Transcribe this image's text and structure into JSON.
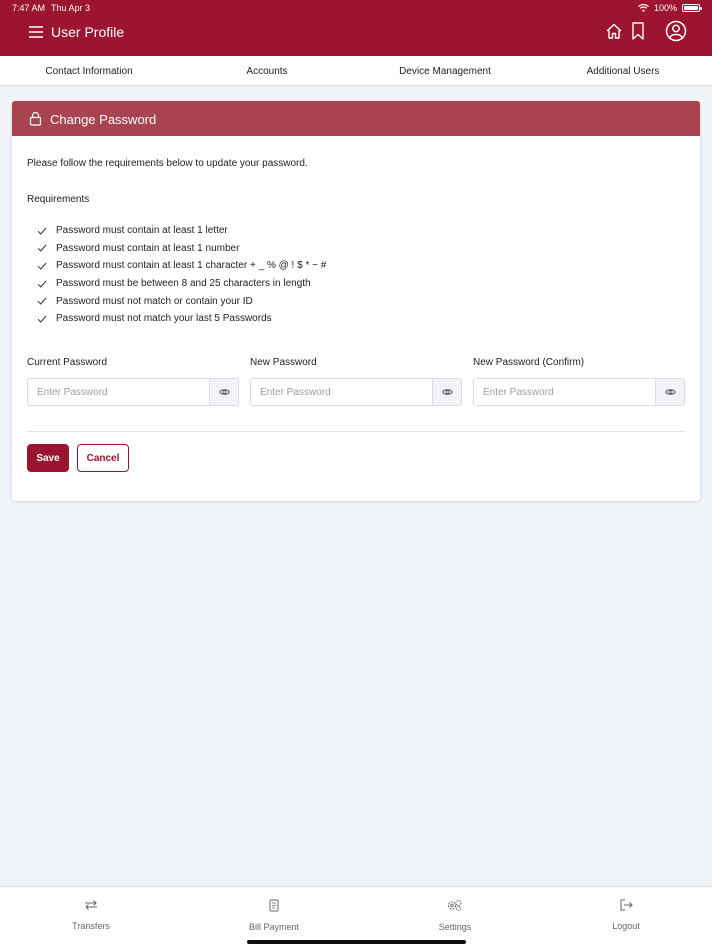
{
  "status_bar": {
    "time": "7:47 AM",
    "date": "Thu Apr 3",
    "battery": "100%",
    "battery_level": 1.0
  },
  "header": {
    "title": "User Profile",
    "icons": [
      "menu-icon",
      "home-icon",
      "bookmark-icon",
      "profile-icon"
    ],
    "background_color": "#9b1430"
  },
  "tabs": [
    {
      "label": "Contact Information"
    },
    {
      "label": "Accounts"
    },
    {
      "label": "Device Management"
    },
    {
      "label": "Additional Users"
    }
  ],
  "card": {
    "title": "Change Password",
    "header_color": "#a8444f",
    "intro": "Please follow the requirements below to update your password.",
    "requirements_heading": "Requirements",
    "requirements": [
      "Password must contain at least 1 letter",
      "Password must contain at least 1 number",
      "Password must contain at least 1 character + _ % @ ! $ * ~ #",
      "Password must be between 8 and 25 characters in length",
      "Password must not match or contain your ID",
      "Password must not match your last 5 Passwords"
    ],
    "fields": [
      {
        "label": "Current Password",
        "placeholder": "Enter Password",
        "value": ""
      },
      {
        "label": "New Password",
        "placeholder": "Enter Password",
        "value": ""
      },
      {
        "label": "New Password (Confirm)",
        "placeholder": "Enter Password",
        "value": ""
      }
    ],
    "save_label": "Save",
    "cancel_label": "Cancel"
  },
  "bottom_nav": [
    {
      "label": "Transfers",
      "icon": "transfer-icon"
    },
    {
      "label": "Bill Payment",
      "icon": "bill-icon"
    },
    {
      "label": "Settings",
      "icon": "settings-icon"
    },
    {
      "label": "Logout",
      "icon": "logout-icon"
    }
  ]
}
